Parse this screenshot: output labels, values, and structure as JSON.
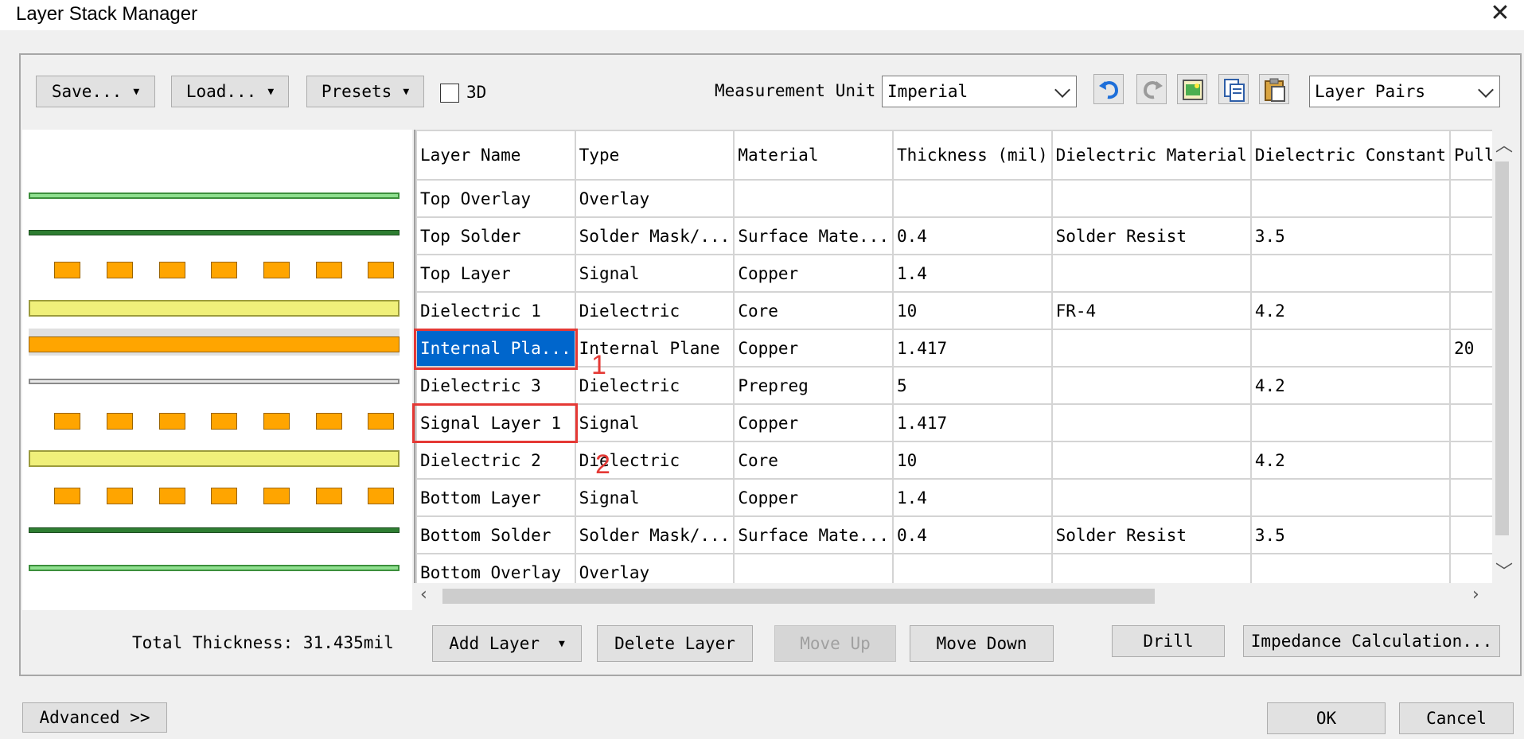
{
  "window": {
    "title": "Layer Stack Manager",
    "close_label": "✕"
  },
  "toolbar": {
    "save_label": "Save...",
    "load_label": "Load...",
    "presets_label": "Presets",
    "three_d_label": "3D",
    "three_d_checked": false,
    "measurement_unit_label": "Measurement Unit",
    "measurement_unit_value": "Imperial",
    "view_mode_value": "Layer Pairs",
    "icons": [
      "undo-icon",
      "redo-icon",
      "add-image-icon",
      "copy-icon",
      "paste-icon"
    ]
  },
  "table": {
    "columns": [
      "Layer Name",
      "Type",
      "Material",
      "Thickness (mil)",
      "Dielectric Material",
      "Dielectric Constant",
      "Pullback"
    ],
    "rows": [
      [
        "Top Overlay",
        "Overlay",
        "",
        "",
        "",
        "",
        ""
      ],
      [
        "Top Solder",
        "Solder Mask/...",
        "Surface Mate...",
        "0.4",
        "Solder Resist",
        "3.5",
        ""
      ],
      [
        "Top Layer",
        "Signal",
        "Copper",
        "1.4",
        "",
        "",
        ""
      ],
      [
        "Dielectric 1",
        "Dielectric",
        "Core",
        "10",
        "FR-4",
        "4.2",
        ""
      ],
      [
        "Internal Pla...",
        "Internal Plane",
        "Copper",
        "1.417",
        "",
        "",
        "20"
      ],
      [
        "Dielectric 3",
        "Dielectric",
        "Prepreg",
        "5",
        "",
        "4.2",
        ""
      ],
      [
        "Signal Layer 1",
        "Signal",
        "Copper",
        "1.417",
        "",
        "",
        ""
      ],
      [
        "Dielectric 2",
        "Dielectric",
        "Core",
        "10",
        "",
        "4.2",
        ""
      ],
      [
        "Bottom Layer",
        "Signal",
        "Copper",
        "1.4",
        "",
        "",
        ""
      ],
      [
        "Bottom Solder",
        "Solder Mask/...",
        "Surface Mate...",
        "0.4",
        "Solder Resist",
        "3.5",
        ""
      ],
      [
        "Bottom Overlay",
        "Overlay",
        "",
        "",
        "",
        "",
        ""
      ]
    ],
    "selected_row": 4
  },
  "annotations": {
    "marker_1": "1",
    "marker_2": "2"
  },
  "footer": {
    "total_thickness": "Total Thickness: 31.435mil",
    "add_layer_label": "Add Layer",
    "delete_layer_label": "Delete Layer",
    "move_up_label": "Move Up",
    "move_down_label": "Move Down",
    "drill_label": "Drill",
    "impedance_label": "Impedance Calculation...",
    "advanced_label": "Advanced >>",
    "ok_label": "OK",
    "cancel_label": "Cancel"
  },
  "colors": {
    "overlay_green": "#8fe08f",
    "solder_green": "#2e7d32",
    "copper_orange": "#ffa500",
    "dielectric_yellow": "#f0f07a",
    "selection_blue": "#0066cc",
    "annotation_red": "#e53935"
  }
}
